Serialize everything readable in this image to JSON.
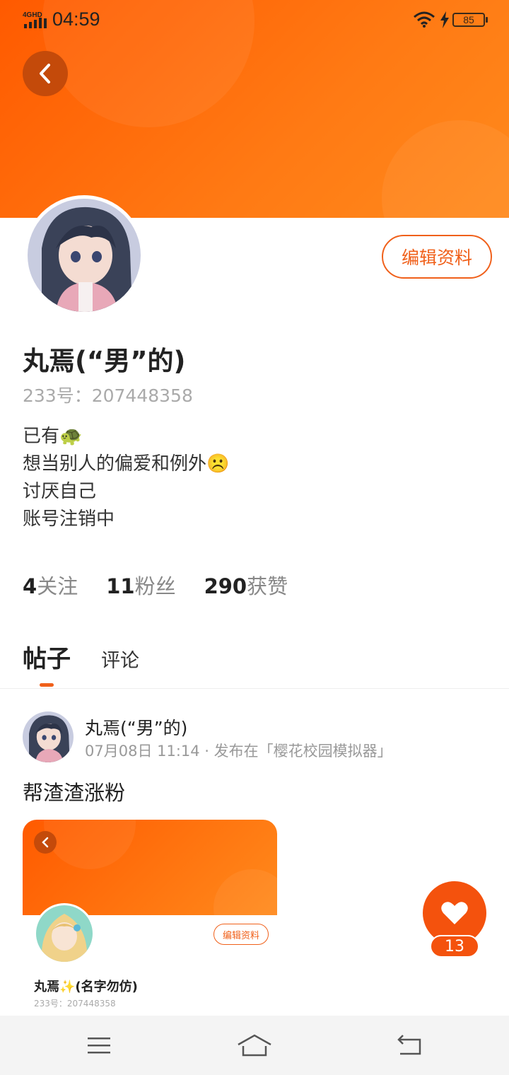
{
  "status_bar": {
    "network": "4GHD",
    "time": "04:59",
    "battery": "85"
  },
  "profile": {
    "edit_label": "编辑资料",
    "name": "丸焉(“男”的)",
    "uid": "233号：207448358",
    "bio": [
      "已有🐢",
      "想当别人的偏爱和例外☹️",
      "讨厌自己",
      "账号注销中"
    ],
    "stats": [
      {
        "num": "4",
        "label": "关注"
      },
      {
        "num": "11",
        "label": "粉丝"
      },
      {
        "num": "290",
        "label": "获赞"
      }
    ]
  },
  "tabs": {
    "posts": "帖子",
    "comments": "评论"
  },
  "post": {
    "author": "丸焉(“男”的)",
    "meta": "07月08日 11:14 · 发布在「樱花校园模拟器」",
    "text": "帮渣渣涨粉",
    "preview": {
      "edit_label": "编辑资料",
      "name": "丸焉✨(名字勿仿)",
      "uid": "233号：207448358"
    },
    "likes": "13"
  },
  "colors": {
    "accent": "#f4520d",
    "banner": "#ff6a0a"
  }
}
